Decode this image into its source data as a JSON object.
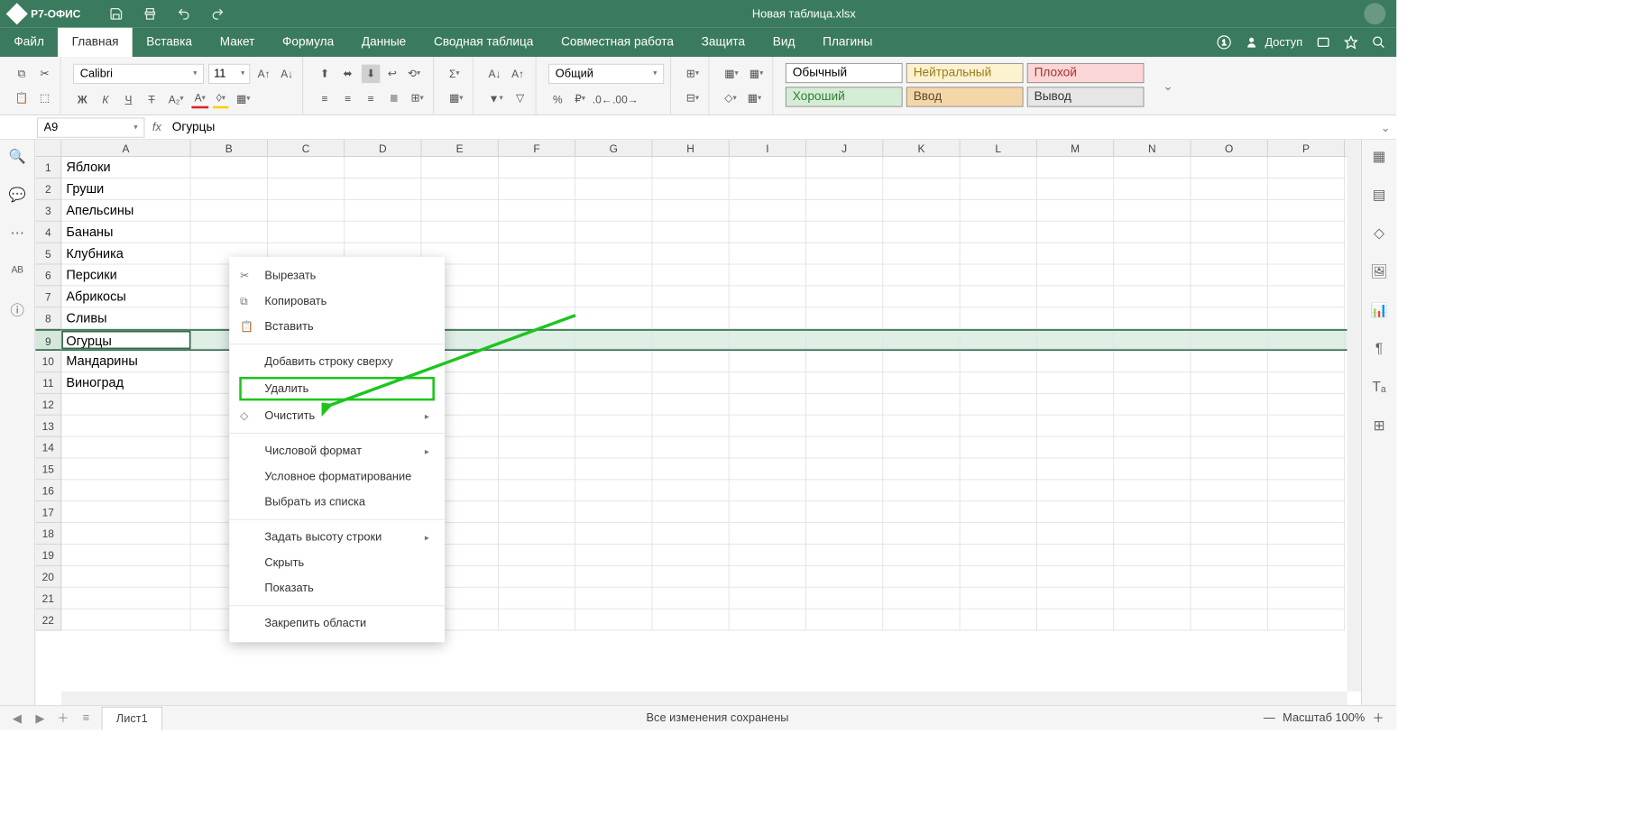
{
  "app": {
    "name": "Р7-ОФИС",
    "doc_title": "Новая таблица.xlsx"
  },
  "menu": {
    "items": [
      "Файл",
      "Главная",
      "Вставка",
      "Макет",
      "Формула",
      "Данные",
      "Сводная таблица",
      "Совместная работа",
      "Защита",
      "Вид",
      "Плагины"
    ],
    "active_index": 1,
    "access_label": "Доступ"
  },
  "toolbar": {
    "font_name": "Calibri",
    "font_size": "11",
    "number_format": "Общий",
    "styles": [
      {
        "label": "Обычный",
        "bg": "#ffffff",
        "fg": "#000"
      },
      {
        "label": "Нейтральный",
        "bg": "#fdf2d0",
        "fg": "#9c7b1a"
      },
      {
        "label": "Плохой",
        "bg": "#fbd6d6",
        "fg": "#a83030"
      },
      {
        "label": "Хороший",
        "bg": "#d5ecd5",
        "fg": "#2e7d32"
      },
      {
        "label": "Ввод",
        "bg": "#f5d6a8",
        "fg": "#5b4a28"
      },
      {
        "label": "Вывод",
        "bg": "#e6e6e6",
        "fg": "#333"
      }
    ]
  },
  "formula_bar": {
    "cell_ref": "A9",
    "fx": "fx",
    "value": "Огурцы"
  },
  "grid": {
    "columns": [
      "A",
      "B",
      "C",
      "D",
      "E",
      "F",
      "G",
      "H",
      "I",
      "J",
      "K",
      "L",
      "M",
      "N",
      "O",
      "P"
    ],
    "row_count": 22,
    "selected_row": 9,
    "data_a": [
      "Яблоки",
      "Груши",
      "Апельсины",
      "Бананы",
      "Клубника",
      "Персики",
      "Абрикосы",
      "Сливы",
      "Огурцы",
      "Мандарины",
      "Виноград"
    ]
  },
  "context_menu": {
    "items": [
      {
        "label": "Вырезать",
        "icon": "✂"
      },
      {
        "label": "Копировать",
        "icon": "⧉"
      },
      {
        "label": "Вставить",
        "icon": "📋"
      },
      {
        "sep": true
      },
      {
        "label": "Добавить строку сверху"
      },
      {
        "label": "Удалить",
        "highlight": true
      },
      {
        "label": "Очистить",
        "icon": "◇",
        "submenu": true
      },
      {
        "sep": true
      },
      {
        "label": "Числовой формат",
        "submenu": true
      },
      {
        "label": "Условное форматирование"
      },
      {
        "label": "Выбрать из списка"
      },
      {
        "sep": true
      },
      {
        "label": "Задать высоту строки",
        "submenu": true
      },
      {
        "label": "Скрыть"
      },
      {
        "label": "Показать"
      },
      {
        "sep": true
      },
      {
        "label": "Закрепить области"
      }
    ]
  },
  "statusbar": {
    "sheet_name": "Лист1",
    "save_status": "Все изменения сохранены",
    "zoom_label": "Масштаб 100%"
  }
}
